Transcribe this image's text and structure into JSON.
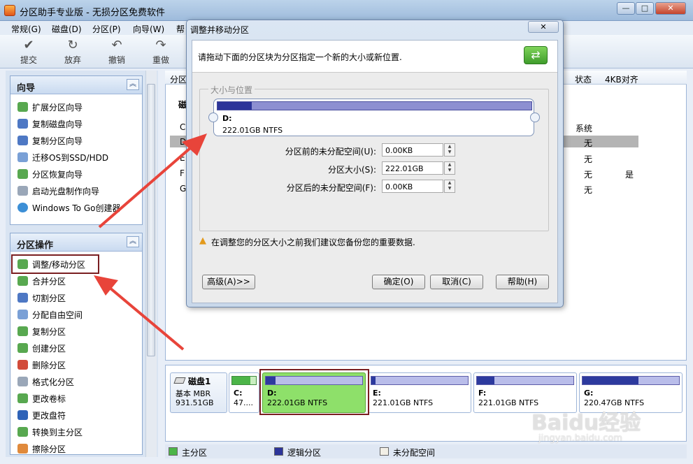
{
  "app": {
    "title": "分区助手专业版 - 无损分区免费软件",
    "window_buttons": [
      "—",
      "□",
      "✕"
    ]
  },
  "menu": [
    "常规(G)",
    "磁盘(D)",
    "分区(P)",
    "向导(W)",
    "帮"
  ],
  "toolbar": [
    {
      "label": "提交",
      "icon": "commit-check-icon"
    },
    {
      "label": "放弃",
      "icon": "discard-icon"
    },
    {
      "label": "撤销",
      "icon": "undo-icon"
    },
    {
      "label": "重做",
      "icon": "redo-icon"
    }
  ],
  "wizard_panel": {
    "title": "向导",
    "items": [
      "扩展分区向导",
      "复制磁盘向导",
      "复制分区向导",
      "迁移OS到SSD/HDD",
      "分区恢复向导",
      "启动光盘制作向导",
      "Windows To Go创建器"
    ]
  },
  "ops_panel": {
    "title": "分区操作",
    "items": [
      "调整/移动分区",
      "合并分区",
      "切割分区",
      "分配自由空间",
      "复制分区",
      "创建分区",
      "删除分区",
      "格式化分区",
      "更改卷标",
      "更改盘符",
      "转换到主分区",
      "擦除分区"
    ]
  },
  "partition_table": {
    "headers": {
      "partition": "分区",
      "status": "状态",
      "align": "4KB对齐"
    },
    "disk_label": "磁",
    "rows": [
      {
        "letter": "C",
        "status": "系统",
        "align": ""
      },
      {
        "letter": "D",
        "status": "无",
        "align": ""
      },
      {
        "letter": "E",
        "status": "无",
        "align": ""
      },
      {
        "letter": "F",
        "status": "无",
        "align": "是"
      },
      {
        "letter": "G",
        "status": "无",
        "align": ""
      }
    ]
  },
  "disk_map": {
    "disk_name": "磁盘1",
    "disk_type": "基本 MBR",
    "disk_size": "931.51GB",
    "partitions": [
      {
        "name": "C:",
        "size": "47....",
        "used_fraction": 0.75
      },
      {
        "name": "D:",
        "size": "222.01GB NTFS",
        "used_fraction": 0.1
      },
      {
        "name": "E:",
        "size": "221.01GB NTFS",
        "used_fraction": 0.04
      },
      {
        "name": "F:",
        "size": "221.01GB NTFS",
        "used_fraction": 0.18
      },
      {
        "name": "G:",
        "size": "220.47GB NTFS",
        "used_fraction": 0.58
      }
    ]
  },
  "legend": {
    "primary": "主分区",
    "logical": "逻辑分区",
    "unallocated": "未分配空间"
  },
  "dialog": {
    "title": "调整并移动分区",
    "close": "✕",
    "instruction": "请拖动下面的分区块为分区指定一个新的大小或新位置.",
    "group_title": "大小与位置",
    "partition_name": "D:",
    "partition_size": "222.01GB NTFS",
    "used_fraction": 0.11,
    "fields": [
      {
        "label": "分区前的未分配空间(U):",
        "value": "0.00KB"
      },
      {
        "label": "分区大小(S):",
        "value": "222.01GB"
      },
      {
        "label": "分区后的未分配空间(F):",
        "value": "0.00KB"
      }
    ],
    "warning": "在调整您的分区大小之前我们建议您备份您的重要数据.",
    "buttons": {
      "advanced": "高级(A)>>",
      "ok": "确定(O)",
      "cancel": "取消(C)",
      "help": "帮助(H)"
    }
  },
  "watermark": {
    "logo": "Baidu经验",
    "url": "jingyan.baidu.com"
  },
  "colors": {
    "accent_red": "#e8443a",
    "box_red": "#7a1e21",
    "selected_green": "#8ee06a",
    "logical_blue": "#2c3499"
  }
}
